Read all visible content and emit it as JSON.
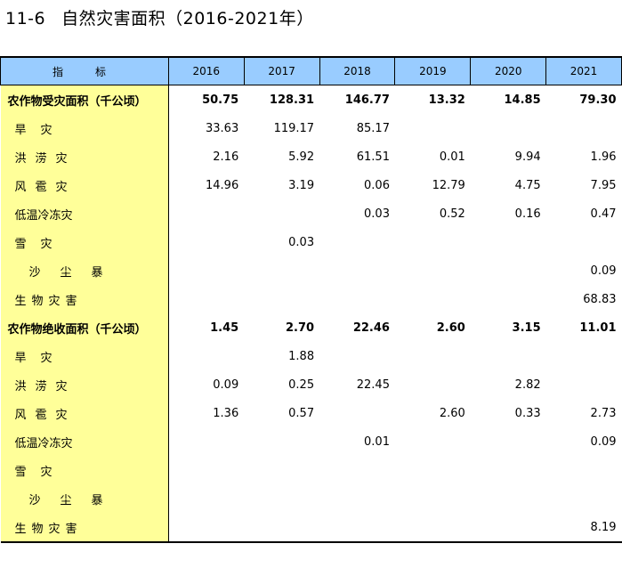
{
  "title": {
    "number": "11-6",
    "text": "自然灾害面积（2016-2021年）"
  },
  "header": {
    "label": "指　标",
    "years": [
      "2016",
      "2017",
      "2018",
      "2019",
      "2020",
      "2021"
    ]
  },
  "rows": [
    {
      "label": "农作物受灾面积（千公顷）",
      "values": [
        "50.75",
        "128.31",
        "146.77",
        "13.32",
        "14.85",
        "79.30"
      ]
    },
    {
      "label": "旱灾",
      "values": [
        "33.63",
        "119.17",
        "85.17",
        "",
        "",
        ""
      ]
    },
    {
      "label": "洪涝灾",
      "values": [
        "2.16",
        "5.92",
        "61.51",
        "0.01",
        "9.94",
        "1.96"
      ]
    },
    {
      "label": "风雹灾",
      "values": [
        "14.96",
        "3.19",
        "0.06",
        "12.79",
        "4.75",
        "7.95"
      ]
    },
    {
      "label": "低温冷冻灾",
      "values": [
        "",
        "",
        "0.03",
        "0.52",
        "0.16",
        "0.47"
      ]
    },
    {
      "label": "雪灾",
      "values": [
        "",
        "0.03",
        "",
        "",
        "",
        ""
      ]
    },
    {
      "label": "沙尘暴",
      "values": [
        "",
        "",
        "",
        "",
        "",
        "0.09"
      ]
    },
    {
      "label": "生物灾害",
      "values": [
        "",
        "",
        "",
        "",
        "",
        "68.83"
      ]
    },
    {
      "label": "农作物绝收面积（千公顷）",
      "values": [
        "1.45",
        "2.70",
        "22.46",
        "2.60",
        "3.15",
        "11.01"
      ]
    },
    {
      "label": "旱灾",
      "values": [
        "",
        "1.88",
        "",
        "",
        "",
        ""
      ]
    },
    {
      "label": "洪涝灾",
      "values": [
        "0.09",
        "0.25",
        "22.45",
        "",
        "2.82",
        ""
      ]
    },
    {
      "label": "风雹灾",
      "values": [
        "1.36",
        "0.57",
        "",
        "2.60",
        "0.33",
        "2.73"
      ]
    },
    {
      "label": "低温冷冻灾",
      "values": [
        "",
        "",
        "0.01",
        "",
        "",
        "0.09"
      ]
    },
    {
      "label": "雪灾",
      "values": [
        "",
        "",
        "",
        "",
        "",
        ""
      ]
    },
    {
      "label": "沙尘暴",
      "values": [
        "",
        "",
        "",
        "",
        "",
        ""
      ]
    },
    {
      "label": "生物灾害",
      "values": [
        "",
        "",
        "",
        "",
        "",
        "8.19"
      ]
    }
  ]
}
